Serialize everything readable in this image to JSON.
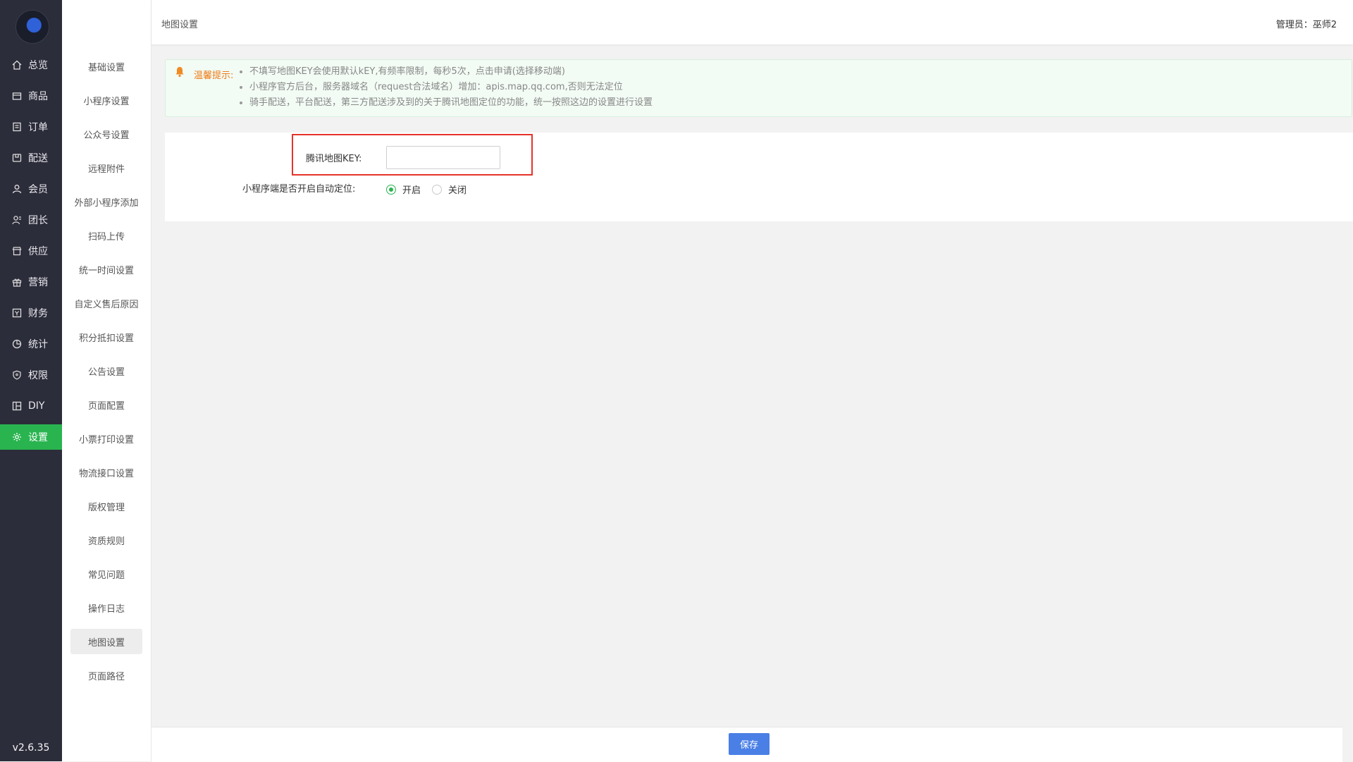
{
  "rail": {
    "items": [
      {
        "label": "总览",
        "icon": "home-icon"
      },
      {
        "label": "商品",
        "icon": "box-icon"
      },
      {
        "label": "订单",
        "icon": "order-icon"
      },
      {
        "label": "配送",
        "icon": "delivery-icon"
      },
      {
        "label": "会员",
        "icon": "user-icon"
      },
      {
        "label": "团长",
        "icon": "leader-icon"
      },
      {
        "label": "供应",
        "icon": "store-icon"
      },
      {
        "label": "营销",
        "icon": "gift-icon"
      },
      {
        "label": "财务",
        "icon": "finance-icon"
      },
      {
        "label": "统计",
        "icon": "pie-chart-icon"
      },
      {
        "label": "权限",
        "icon": "shield-icon"
      },
      {
        "label": "DIY",
        "icon": "layout-icon"
      },
      {
        "label": "设置",
        "icon": "gear-icon"
      }
    ],
    "active_index": 12,
    "version": "v2.6.35"
  },
  "subnav": {
    "items": [
      "基础设置",
      "小程序设置",
      "公众号设置",
      "远程附件",
      "外部小程序添加",
      "扫码上传",
      "统一时间设置",
      "自定义售后原因",
      "积分抵扣设置",
      "公告设置",
      "页面配置",
      "小票打印设置",
      "物流接口设置",
      "版权管理",
      "资质规则",
      "常见问题",
      "操作日志",
      "地图设置",
      "页面路径"
    ],
    "active_index": 17
  },
  "header": {
    "breadcrumb": "地图设置",
    "admin": "管理员：巫师2"
  },
  "notice": {
    "title": "温馨提示:",
    "items": [
      "不填写地图KEY会使用默认kEY,有频率限制，每秒5次，点击申请(选择移动端)",
      "小程序官方后台，服务器域名（request合法域名）增加：apis.map.qq.com,否则无法定位",
      "骑手配送，平台配送，第三方配送涉及到的关于腾讯地图定位的功能，统一按照这边的设置进行设置"
    ]
  },
  "form": {
    "key_label": "腾讯地图KEY:",
    "key_value": "",
    "location_label": "小程序端是否开启自动定位:",
    "location_options": [
      "开启",
      "关闭"
    ],
    "location_selected": "开启"
  },
  "footer": {
    "save_label": "保存"
  },
  "colors": {
    "rail_bg": "#2c2d3a",
    "accent_green": "#29b450",
    "save_blue": "#4a7fe5",
    "highlight_red": "#e5332a",
    "notice_orange": "#ef7d1a"
  }
}
